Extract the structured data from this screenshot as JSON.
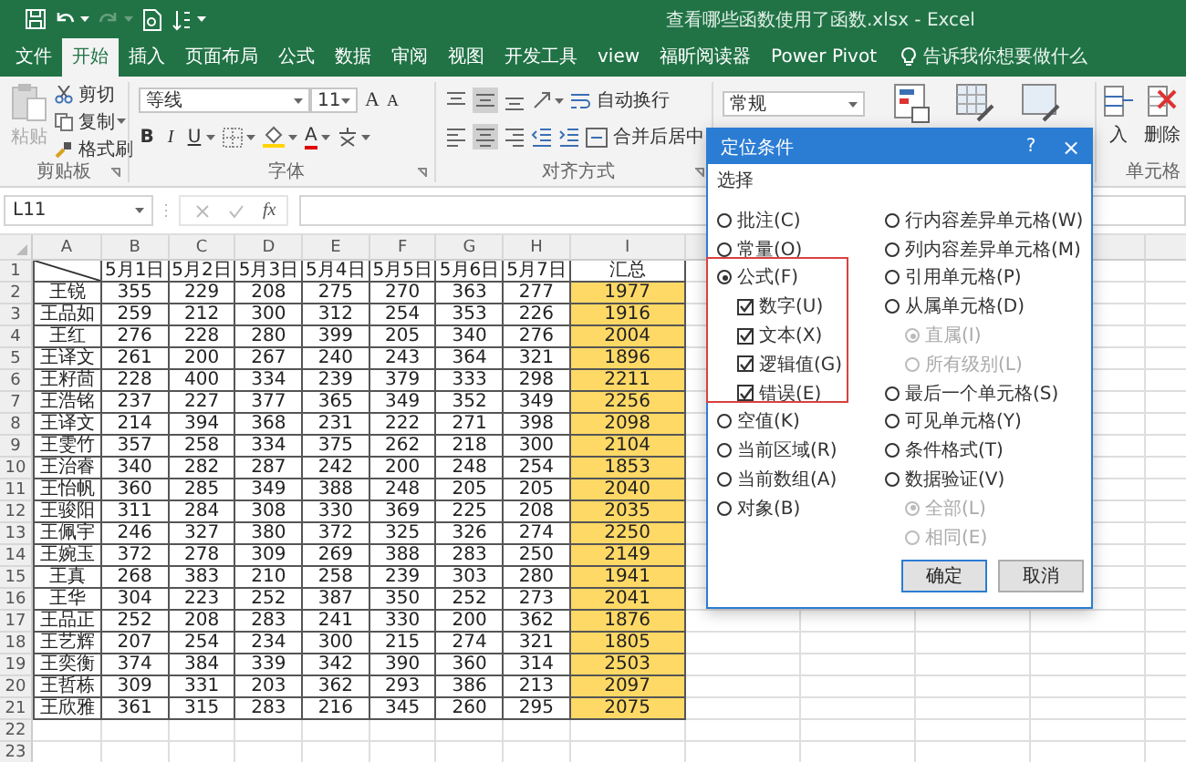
{
  "window": {
    "title": "查看哪些函数使用了函数.xlsx - Excel"
  },
  "tabs": [
    {
      "label": "文件",
      "selected": false
    },
    {
      "label": "开始",
      "selected": true
    },
    {
      "label": "插入",
      "selected": false
    },
    {
      "label": "页面布局",
      "selected": false
    },
    {
      "label": "公式",
      "selected": false
    },
    {
      "label": "数据",
      "selected": false
    },
    {
      "label": "审阅",
      "selected": false
    },
    {
      "label": "视图",
      "selected": false
    },
    {
      "label": "开发工具",
      "selected": false
    },
    {
      "label": "view",
      "selected": false
    },
    {
      "label": "福昕阅读器",
      "selected": false
    },
    {
      "label": "Power Pivot",
      "selected": false
    }
  ],
  "tell_me": "告诉我你想要做什么",
  "ribbon": {
    "clipboard": {
      "paste": "粘贴",
      "cut": "剪切",
      "copy": "复制",
      "format_painter": "格式刷",
      "group": "剪贴板"
    },
    "font": {
      "name": "等线",
      "size": "11",
      "grow": "A",
      "shrink": "A",
      "bold": "B",
      "italic": "I",
      "underline": "U",
      "font_color_glyph": "A",
      "group": "字体"
    },
    "alignment": {
      "wrap": "自动换行",
      "merge": "合并后居中",
      "group": "对齐方式"
    },
    "number": {
      "format": "常规"
    },
    "cells": {
      "insert": "入",
      "delete": "删除",
      "group": "单元格"
    }
  },
  "formula_bar": {
    "name_box": "L11",
    "fx": "fx"
  },
  "sheet": {
    "corner_diagonal": true,
    "columns": [
      {
        "label": "A",
        "highlighted": false
      },
      {
        "label": "B",
        "highlighted": false
      },
      {
        "label": "C",
        "highlighted": false
      },
      {
        "label": "D",
        "highlighted": false
      },
      {
        "label": "E",
        "highlighted": false
      },
      {
        "label": "F",
        "highlighted": false
      },
      {
        "label": "G",
        "highlighted": false
      },
      {
        "label": "H",
        "highlighted": false
      },
      {
        "label": "I",
        "highlighted": true
      }
    ],
    "rows": [
      {
        "number": "1",
        "kind": "header",
        "cells": [
          "",
          "5月1日",
          "5月2日",
          "5月3日",
          "5月4日",
          "5月5日",
          "5月6日",
          "5月7日",
          "汇总"
        ]
      },
      {
        "number": "2",
        "kind": "data",
        "cells": [
          "王锐",
          "355",
          "229",
          "208",
          "275",
          "270",
          "363",
          "277",
          "1977"
        ]
      },
      {
        "number": "3",
        "kind": "data",
        "cells": [
          "王品如",
          "259",
          "212",
          "300",
          "312",
          "254",
          "353",
          "226",
          "1916"
        ]
      },
      {
        "number": "4",
        "kind": "data",
        "cells": [
          "王红",
          "276",
          "228",
          "280",
          "399",
          "205",
          "340",
          "276",
          "2004"
        ]
      },
      {
        "number": "5",
        "kind": "data",
        "cells": [
          "王译文",
          "261",
          "200",
          "267",
          "240",
          "243",
          "364",
          "321",
          "1896"
        ]
      },
      {
        "number": "6",
        "kind": "data",
        "cells": [
          "王籽茴",
          "228",
          "400",
          "334",
          "239",
          "379",
          "333",
          "298",
          "2211"
        ]
      },
      {
        "number": "7",
        "kind": "data",
        "cells": [
          "王浩铭",
          "237",
          "227",
          "377",
          "365",
          "349",
          "352",
          "349",
          "2256"
        ]
      },
      {
        "number": "8",
        "kind": "data",
        "cells": [
          "王译文",
          "214",
          "394",
          "368",
          "231",
          "222",
          "271",
          "398",
          "2098"
        ]
      },
      {
        "number": "9",
        "kind": "data",
        "cells": [
          "王雯竹",
          "357",
          "258",
          "334",
          "375",
          "262",
          "218",
          "300",
          "2104"
        ]
      },
      {
        "number": "10",
        "kind": "data",
        "cells": [
          "王治睿",
          "340",
          "282",
          "287",
          "242",
          "200",
          "248",
          "254",
          "1853"
        ]
      },
      {
        "number": "11",
        "kind": "data",
        "cells": [
          "王怡帆",
          "360",
          "285",
          "349",
          "388",
          "248",
          "205",
          "205",
          "2040"
        ]
      },
      {
        "number": "12",
        "kind": "data",
        "cells": [
          "王骏阳",
          "311",
          "284",
          "308",
          "330",
          "369",
          "225",
          "208",
          "2035"
        ]
      },
      {
        "number": "13",
        "kind": "data",
        "cells": [
          "王佩宇",
          "246",
          "327",
          "380",
          "372",
          "325",
          "326",
          "274",
          "2250"
        ]
      },
      {
        "number": "14",
        "kind": "data",
        "cells": [
          "王婉玉",
          "372",
          "278",
          "309",
          "269",
          "388",
          "283",
          "250",
          "2149"
        ]
      },
      {
        "number": "15",
        "kind": "data",
        "cells": [
          "王真",
          "268",
          "383",
          "210",
          "258",
          "239",
          "303",
          "280",
          "1941"
        ]
      },
      {
        "number": "16",
        "kind": "data",
        "cells": [
          "王华",
          "304",
          "223",
          "252",
          "387",
          "350",
          "252",
          "273",
          "2041"
        ]
      },
      {
        "number": "17",
        "kind": "data",
        "cells": [
          "王品正",
          "252",
          "208",
          "283",
          "241",
          "330",
          "200",
          "362",
          "1876"
        ]
      },
      {
        "number": "18",
        "kind": "data",
        "cells": [
          "王艺辉",
          "207",
          "254",
          "234",
          "300",
          "215",
          "274",
          "321",
          "1805"
        ]
      },
      {
        "number": "19",
        "kind": "data",
        "cells": [
          "王奕衡",
          "374",
          "384",
          "339",
          "342",
          "390",
          "360",
          "314",
          "2503"
        ]
      },
      {
        "number": "20",
        "kind": "data",
        "cells": [
          "王哲栋",
          "309",
          "331",
          "203",
          "362",
          "293",
          "386",
          "213",
          "2097"
        ]
      },
      {
        "number": "21",
        "kind": "data",
        "cells": [
          "王欣雅",
          "361",
          "315",
          "283",
          "216",
          "345",
          "260",
          "295",
          "2075"
        ]
      },
      {
        "number": "22",
        "kind": "empty",
        "cells": []
      },
      {
        "number": "23",
        "kind": "empty",
        "cells": []
      }
    ]
  },
  "dialog": {
    "title": "定位条件",
    "help": "?",
    "close": "×",
    "section": "选择",
    "left": [
      {
        "kind": "radio",
        "label": "批注(C)",
        "selected": false,
        "disabled": false
      },
      {
        "kind": "radio",
        "label": "常量(O)",
        "selected": false,
        "disabled": false
      },
      {
        "kind": "radio",
        "label": "公式(F)",
        "selected": true,
        "disabled": false,
        "highlighted": true,
        "children": [
          {
            "kind": "checkbox",
            "label": "数字(U)",
            "checked": true,
            "disabled": false
          },
          {
            "kind": "checkbox",
            "label": "文本(X)",
            "checked": true,
            "disabled": false
          },
          {
            "kind": "checkbox",
            "label": "逻辑值(G)",
            "checked": true,
            "disabled": false
          },
          {
            "kind": "checkbox",
            "label": "错误(E)",
            "checked": true,
            "disabled": false
          }
        ]
      },
      {
        "kind": "radio",
        "label": "空值(K)",
        "selected": false,
        "disabled": false
      },
      {
        "kind": "radio",
        "label": "当前区域(R)",
        "selected": false,
        "disabled": false
      },
      {
        "kind": "radio",
        "label": "当前数组(A)",
        "selected": false,
        "disabled": false
      },
      {
        "kind": "radio",
        "label": "对象(B)",
        "selected": false,
        "disabled": false
      }
    ],
    "right": [
      {
        "kind": "radio",
        "label": "行内容差异单元格(W)",
        "selected": false,
        "disabled": false
      },
      {
        "kind": "radio",
        "label": "列内容差异单元格(M)",
        "selected": false,
        "disabled": false
      },
      {
        "kind": "radio",
        "label": "引用单元格(P)",
        "selected": false,
        "disabled": false
      },
      {
        "kind": "radio",
        "label": "从属单元格(D)",
        "selected": false,
        "disabled": false,
        "children": [
          {
            "kind": "radio",
            "label": "直属(I)",
            "selected": true,
            "disabled": true
          },
          {
            "kind": "radio",
            "label": "所有级别(L)",
            "selected": false,
            "disabled": true
          }
        ]
      },
      {
        "kind": "radio",
        "label": "最后一个单元格(S)",
        "selected": false,
        "disabled": false
      },
      {
        "kind": "radio",
        "label": "可见单元格(Y)",
        "selected": false,
        "disabled": false
      },
      {
        "kind": "radio",
        "label": "条件格式(T)",
        "selected": false,
        "disabled": false
      },
      {
        "kind": "radio",
        "label": "数据验证(V)",
        "selected": false,
        "disabled": false,
        "children": [
          {
            "kind": "radio",
            "label": "全部(L)",
            "selected": true,
            "disabled": true
          },
          {
            "kind": "radio",
            "label": "相同(E)",
            "selected": false,
            "disabled": true
          }
        ]
      }
    ],
    "buttons": [
      {
        "label": "确定",
        "default": true
      },
      {
        "label": "取消",
        "default": false
      }
    ]
  }
}
